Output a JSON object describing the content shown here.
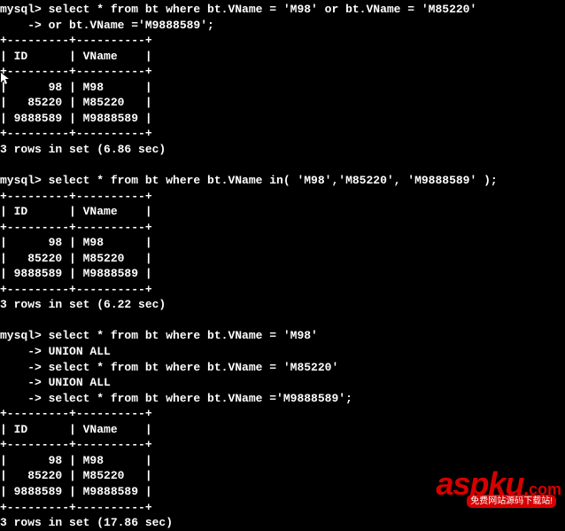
{
  "queries": [
    {
      "prompt1": "mysql> select * from bt where bt.VName = 'M98' or bt.VName = 'M85220'",
      "prompt2": "    -> or bt.VName ='M9888589';",
      "divider": "+---------+----------+",
      "header": "| ID      | VName    |",
      "rows": [
        "|      98 | M98      |",
        "|   85220 | M85220   |",
        "| 9888589 | M9888589 |"
      ],
      "footer": "3 rows in set (6.86 sec)"
    },
    {
      "prompt1": "mysql> select * from bt where bt.VName in( 'M98','M85220', 'M9888589' );",
      "divider": "+---------+----------+",
      "header": "| ID      | VName    |",
      "rows": [
        "|      98 | M98      |",
        "|   85220 | M85220   |",
        "| 9888589 | M9888589 |"
      ],
      "footer": "3 rows in set (6.22 sec)"
    },
    {
      "prompt1": "mysql> select * from bt where bt.VName = 'M98'",
      "prompt2": "    -> UNION ALL",
      "prompt3": "    -> select * from bt where bt.VName = 'M85220'",
      "prompt4": "    -> UNION ALL",
      "prompt5": "    -> select * from bt where bt.VName ='M9888589';",
      "divider": "+---------+----------+",
      "header": "| ID      | VName    |",
      "rows": [
        "|      98 | M98      |",
        "|   85220 | M85220   |",
        "| 9888589 | M9888589 |"
      ],
      "footer": "3 rows in set (17.86 sec)"
    }
  ],
  "logo": {
    "main": "aspku",
    "dot": ".",
    "com": "com",
    "sub": "免费网站源码下载站!"
  },
  "chart_data": {
    "type": "table",
    "title": "MySQL query results comparison",
    "columns": [
      "ID",
      "VName"
    ],
    "rows": [
      [
        98,
        "M98"
      ],
      [
        85220,
        "M85220"
      ],
      [
        9888589,
        "M9888589"
      ]
    ],
    "timings": [
      {
        "query": "OR conditions",
        "seconds": 6.86
      },
      {
        "query": "IN clause",
        "seconds": 6.22
      },
      {
        "query": "UNION ALL",
        "seconds": 17.86
      }
    ]
  }
}
